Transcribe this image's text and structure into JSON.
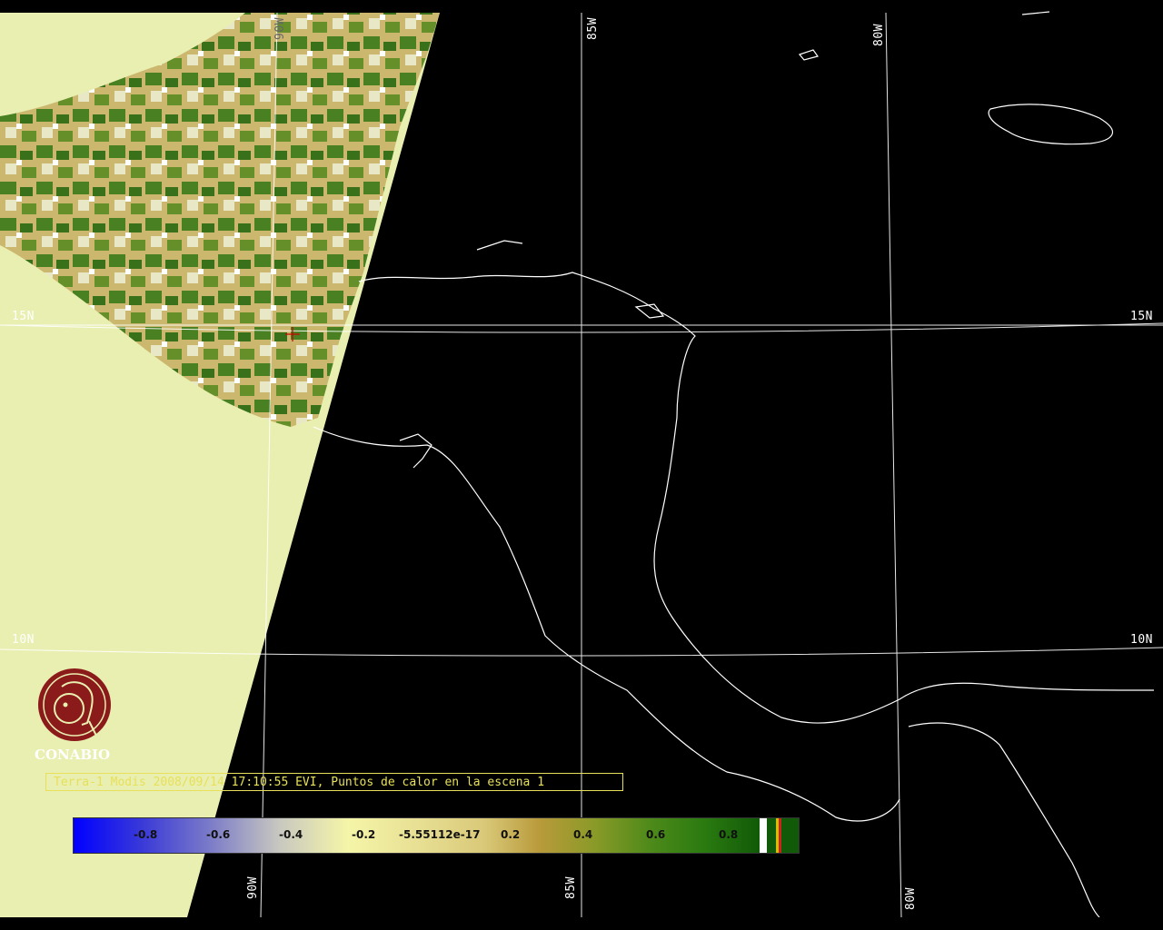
{
  "map": {
    "grid_labels": {
      "top_85w": "85W",
      "top_80w": "80W",
      "top_90w": "90W",
      "left_15n": "15N",
      "right_15n": "15N",
      "left_10n": "10N",
      "right_10n": "10N",
      "bottom_90w": "90W",
      "bottom_85w": "85W",
      "bottom_80w": "80W"
    },
    "caption": "Terra-1 Modis 2008/09/14 17:10:55 EVI, Puntos de calor en la escena 1",
    "logo_text": "CONABIO",
    "colors": {
      "background": "#000000",
      "no_data": "#e9efb0",
      "coastline": "#ffffff",
      "vegetation_high": "#2a7a10",
      "vegetation_mid": "#b89a3a",
      "hotspot_marker": "#cc0000",
      "caption": "#e8e05a",
      "logo": "#8b1a1a"
    }
  },
  "legend": {
    "ticks": [
      "-0.8",
      "-0.6",
      "-0.4",
      "-0.2",
      "-5.55112e-17",
      "0.2",
      "0.4",
      "0.6",
      "0.8"
    ],
    "extra_swatches": [
      "#ffffff",
      "#111111",
      "#d4c000",
      "#cc2222"
    ]
  }
}
